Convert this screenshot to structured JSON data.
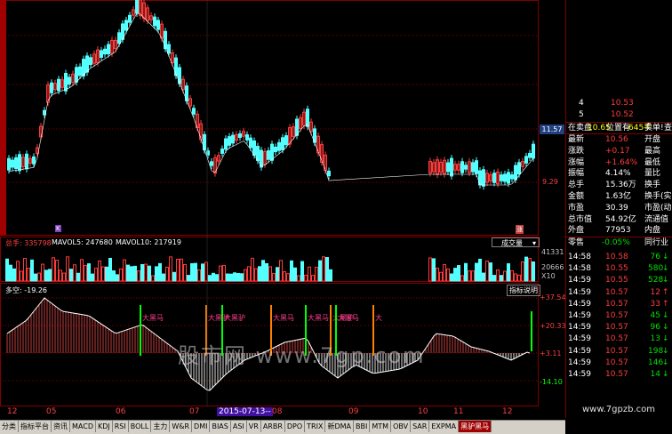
{
  "colors": {
    "up": "#ff3c3c",
    "down": "#54ffff",
    "grid": "#800000",
    "background": "#000000",
    "text": "#c0c0c0",
    "ma1": "#ffffff",
    "ma2": "#ffff00",
    "ma3": "#ff00ff"
  },
  "price_panel": {
    "current_price_tag": "11.57",
    "low_price_tag": "9.29",
    "marker_left": "K",
    "marker_right": "涨"
  },
  "volume_panel": {
    "total_label": "总手: 335798",
    "mavol5_label": "MAVOL5: 247680",
    "mavol10_label": "MAVOL10: 217919",
    "dropdown_label": "成交量",
    "axis_top": "41331",
    "axis_mid": "20666",
    "axis_unit": "X10"
  },
  "indicator_panel": {
    "title": "多空: -19.26",
    "help_button": "指标说明",
    "axis": [
      "+37.54",
      "+20.33",
      "+3.11",
      "-14.10"
    ],
    "signals": [
      "大黑马",
      "大黑驴",
      "大黑驴",
      "大黑马",
      "大黑马",
      "大黑驴",
      "大黑马",
      "大"
    ]
  },
  "date_axis": {
    "labels": [
      "12",
      "05",
      "06",
      "07",
      "2015-07-13--",
      "08",
      "09",
      "10",
      "11",
      "12"
    ]
  },
  "watermark": "股市网 www.7gp.com",
  "site_watermark": "www.7gpzb.com",
  "right_panel": {
    "ask_rows": [
      {
        "level": "4",
        "price": "10.53"
      },
      {
        "level": "5",
        "price": "10.52"
      }
    ],
    "trade_header": {
      "a": "在卖盘",
      "b": "10.65",
      "c": "位置有",
      "d": "645手",
      "e": "卖单!",
      "f": "查看"
    },
    "quotes": [
      {
        "l1": "最新",
        "v1": "10.56",
        "l2": "开盘",
        "v2": ""
      },
      {
        "l1": "涨跌",
        "v1": "+0.17",
        "l2": "最高",
        "v2": ""
      },
      {
        "l1": "涨幅",
        "v1": "+1.64%",
        "l2": "最低",
        "v2": ""
      },
      {
        "l1": "振幅",
        "v1": "4.14%",
        "l2": "量比",
        "v2": ""
      },
      {
        "l1": "总手",
        "v1": "15.36万",
        "l2": "换手",
        "v2": ""
      },
      {
        "l1": "金额",
        "v1": "1.63亿",
        "l2": "换手(实)",
        "v2": ""
      },
      {
        "l1": "市盈",
        "v1": "30.39",
        "l2": "市盈(动)",
        "v2": ""
      },
      {
        "l1": "总市值",
        "v1": "54.92亿",
        "l2": "流通值",
        "v2": ""
      },
      {
        "l1": "外盘",
        "v1": "77953",
        "l2": "内盘",
        "v2": ""
      }
    ],
    "tick_header": {
      "left": "零售",
      "mid": "-0.05%",
      "right": "同行业"
    },
    "ticks": [
      {
        "time": "14:58",
        "price": "10.58",
        "vol": "76",
        "dir": "down"
      },
      {
        "time": "14:58",
        "price": "10.55",
        "vol": "580",
        "dir": "down"
      },
      {
        "time": "14:59",
        "price": "10.55",
        "vol": "528",
        "dir": "down"
      },
      {
        "time": "14:59",
        "price": "10.57",
        "vol": "12",
        "dir": "up"
      },
      {
        "time": "14:59",
        "price": "10.57",
        "vol": "33",
        "dir": "up"
      },
      {
        "time": "14:59",
        "price": "10.57",
        "vol": "45",
        "dir": "down"
      },
      {
        "time": "14:59",
        "price": "10.57",
        "vol": "96",
        "dir": "down"
      },
      {
        "time": "14:59",
        "price": "10.57",
        "vol": "13",
        "dir": "down"
      },
      {
        "time": "14:59",
        "price": "10.57",
        "vol": "198",
        "dir": "down"
      },
      {
        "time": "14:59",
        "price": "10.57",
        "vol": "146",
        "dir": "down"
      },
      {
        "time": "14:59",
        "price": "10.57",
        "vol": "14",
        "dir": "down"
      }
    ]
  },
  "tabs": [
    "分类",
    "指标平台",
    "资讯",
    "MACD",
    "KDJ",
    "RSI",
    "BOLL",
    "主力",
    "W&R",
    "DMI",
    "BIAS",
    "ASI",
    "VR",
    "ARBR",
    "DPO",
    "TRIX",
    "新DMA",
    "BBI",
    "MTM",
    "OBV",
    "SAR",
    "EXPMA",
    "黑驴黑马"
  ],
  "active_tab": "黑驴黑马"
}
